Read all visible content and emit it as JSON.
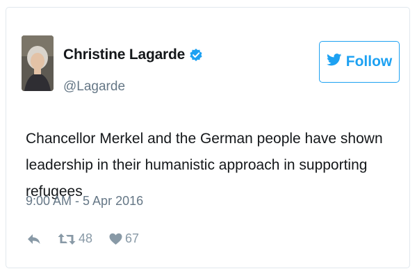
{
  "author": {
    "display_name": "Christine Lagarde",
    "handle": "@Lagarde",
    "verified": true,
    "avatar_icon": "profile-photo"
  },
  "follow_button": {
    "label": "Follow",
    "icon": "twitter-bird-icon",
    "color": "#1da1f2"
  },
  "tweet": {
    "text": "Chancellor Merkel and the German people have shown leadership in their humanistic approach in supporting refugees",
    "timestamp": "9:00 AM - 5 Apr 2016"
  },
  "actions": {
    "reply": {
      "icon": "reply-icon"
    },
    "retweet": {
      "icon": "retweet-icon",
      "count": "48"
    },
    "like": {
      "icon": "heart-icon",
      "count": "67"
    }
  }
}
